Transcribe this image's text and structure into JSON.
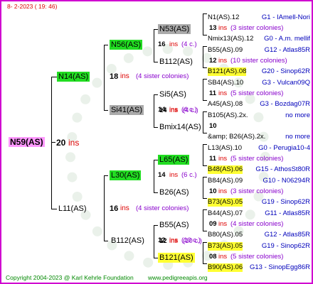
{
  "header": {
    "date": "8- 2-2023 ( 19: 46)"
  },
  "footer": {
    "copyright": "Copyright 2004-2023 @ Karl Kehrle Foundation",
    "site": "www.pedigreeapis.org"
  },
  "root": {
    "label": "N59(AS)",
    "num": "20",
    "ins": "ins"
  },
  "gen1": [
    {
      "label": "N14(AS)",
      "num": "18",
      "ins": "ins",
      "note": "(4 sister colonies)"
    },
    {
      "label": "L11(AS)",
      "num": "16",
      "ins": "ins",
      "note": "(4 sister colonies)"
    }
  ],
  "gen2": [
    {
      "label": "N56(AS)",
      "num": "",
      "ins": "",
      "note": ""
    },
    {
      "label": "Si41(AS)",
      "num": "14",
      "ins": "ins",
      "note": "(4 c.)"
    },
    {
      "label": "L30(AS)",
      "num": "",
      "ins": "",
      "note": ""
    },
    {
      "label": "B112(AS)",
      "num": "12",
      "ins": "ins",
      "note": "(10 c.)"
    }
  ],
  "gen3": [
    {
      "label": "N53(AS)",
      "num": "16",
      "ins": "ins",
      "note": "(4 c.)"
    },
    {
      "label": "B112(AS)",
      "num": "",
      "ins": "",
      "note": ""
    },
    {
      "label": "Si5(AS)",
      "num": "14",
      "ins": "ins",
      "note": "(4 c.)"
    },
    {
      "label": "Bmix14(AS)",
      "num": "",
      "ins": "",
      "note": ""
    },
    {
      "label": "L65(AS)",
      "num": "14",
      "ins": "ins",
      "note": "(6 c.)"
    },
    {
      "label": "B26(AS)",
      "num": "",
      "ins": "",
      "note": ""
    },
    {
      "label": "B55(AS)",
      "num": "12",
      "ins": "ins",
      "note": "(10 c.)"
    },
    {
      "label": "B121(AS)",
      "num": "",
      "ins": "",
      "note": ""
    }
  ],
  "gen4": [
    {
      "a": "N1(AS).12",
      "ar": "G1 - IAmell-Nori",
      "num": "13",
      "ins": "ins",
      "note": "(3 sister colonies)",
      "b": "Nmix13(AS).12",
      "br": "G0 - A.m. mellif"
    },
    {
      "a": "B55(AS).09",
      "ar": "G12 - Atlas85R",
      "num": "12",
      "ins": "ins",
      "note": "(10 sister colonies)",
      "b": "B121(AS).08",
      "br": "G20 - Sinop62R"
    },
    {
      "a": "SB4(AS).10",
      "ar": "G3 - Vulcan09Q",
      "num": "11",
      "ins": "ins",
      "note": "(5 sister colonies)",
      "b": "A45(AS).08",
      "br": "G3 - Bozdag07R"
    },
    {
      "a": "B105(AS).2x.",
      "ar": "no more",
      "num": "10",
      "ins": "",
      "note": "",
      "b": "&amp; B26(AS).2x.",
      "br": "no more"
    },
    {
      "a": "L13(AS).10",
      "ar": "G0 - Perugia10-4",
      "num": "11",
      "ins": "ins",
      "note": "(5 sister colonies)",
      "b": "B48(AS).06",
      "br": "G15 - AthosSt80R"
    },
    {
      "a": "B84(AS).09",
      "ar": "G10 - N06294R",
      "num": "10",
      "ins": "ins",
      "note": "(3 sister colonies)",
      "b": "B73(AS).05",
      "br": "G19 - Sinop62R"
    },
    {
      "a": "B44(AS).07",
      "ar": "G11 - Atlas85R",
      "num": "09",
      "ins": "ins",
      "note": "(4 sister colonies)",
      "b": "B80(AS).05",
      "br": "G12 - Atlas85R"
    },
    {
      "a": "B73(AS).05",
      "ar": "G19 - Sinop62R",
      "num": "08",
      "ins": "ins",
      "note": "(5 sister colonies)",
      "b": "B90(AS).06",
      "br": "G13 - SinopEgg86R"
    }
  ]
}
